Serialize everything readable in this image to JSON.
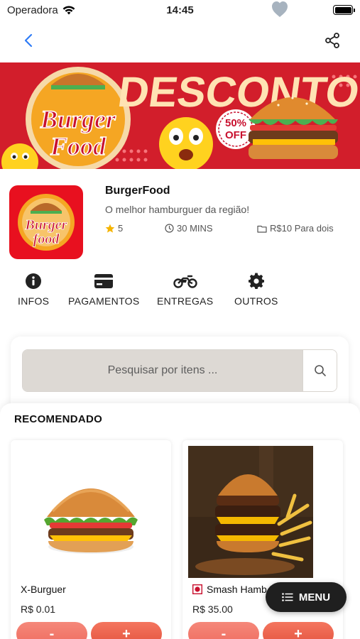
{
  "status_bar": {
    "carrier": "Operadora",
    "time": "14:45"
  },
  "nav": {
    "back_icon": "chevron-left-icon",
    "share_icon": "share-icon"
  },
  "banner": {
    "brand_line1": "Burger",
    "brand_line2": "Food",
    "headline": "DESCONTO",
    "badge_line1": "50%",
    "badge_line2": "OFF",
    "colors": {
      "background": "#d9222e",
      "headline": "#ffe3b3",
      "brand_red": "#c8102e"
    }
  },
  "store": {
    "logo_line1": "Burger",
    "logo_line2": "food",
    "name": "BurgerFood",
    "description": "O melhor hamburguer da região!",
    "rating": "5",
    "delivery_time": "30 MINS",
    "price_for_two": "R$10 Para dois"
  },
  "tabs": [
    {
      "label": "INFOS",
      "icon": "info-icon"
    },
    {
      "label": "PAGAMENTOS",
      "icon": "credit-card-icon"
    },
    {
      "label": "ENTREGAS",
      "icon": "motorcycle-icon"
    },
    {
      "label": "OUTROS",
      "icon": "gear-icon"
    }
  ],
  "search": {
    "placeholder": "Pesquisar por itens ..."
  },
  "recommended": {
    "title": "RECOMENDADO",
    "products": [
      {
        "name": "X-Burguer",
        "price": "R$ 0.01",
        "minus": "-",
        "plus": "+"
      },
      {
        "name": "Smash Hamb",
        "price": "R$ 35.00",
        "minus": "-",
        "plus": "+"
      }
    ]
  },
  "menu_button": {
    "label": "MENU",
    "icon": "list-icon"
  },
  "colors": {
    "accent": "#e4533e",
    "search_bg": "#ddd9d4",
    "fab_bg": "#1f1f1f"
  }
}
